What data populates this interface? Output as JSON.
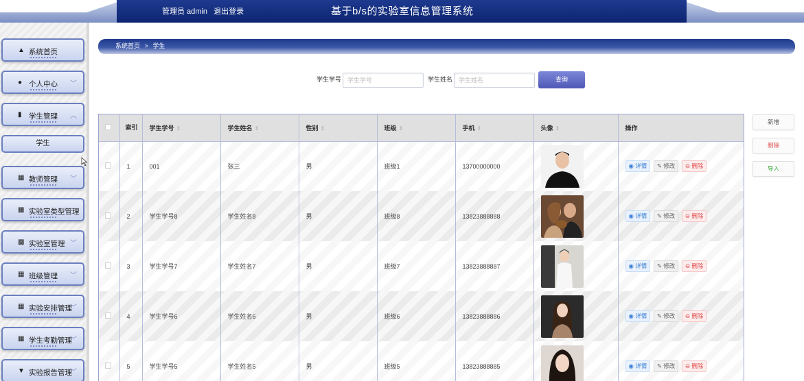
{
  "header": {
    "user_role": "管理员 admin",
    "logout": "退出登录",
    "title": "基于b/s的实验室信息管理系统"
  },
  "sidebar": {
    "items": [
      {
        "label": "系统首页",
        "icon": "home-icon",
        "arrow": ""
      },
      {
        "label": "个人中心",
        "icon": "user-icon",
        "arrow": "﹀"
      },
      {
        "label": "学生管理",
        "icon": "bar-chart-icon",
        "arrow": "︿"
      },
      {
        "label": "教师管理",
        "icon": "grid-icon",
        "arrow": "﹀"
      },
      {
        "label": "实验室类型管理",
        "icon": "grid-icon",
        "arrow": ""
      },
      {
        "label": "实验室管理",
        "icon": "card-icon",
        "arrow": "﹀"
      },
      {
        "label": "班级管理",
        "icon": "grid-icon",
        "arrow": "﹀"
      },
      {
        "label": "实验安排管理",
        "icon": "grid-icon",
        "arrow": "﹀"
      },
      {
        "label": "学生考勤管理",
        "icon": "grid-icon",
        "arrow": "﹀"
      },
      {
        "label": "实验报告管理",
        "icon": "report-icon",
        "arrow": "﹀"
      }
    ],
    "sub_item": "学生"
  },
  "breadcrumb": {
    "home": "系统首页",
    "sep": ">",
    "current": "学生"
  },
  "search": {
    "field1_label": "学生学号",
    "field1_placeholder": "学生学号",
    "field2_label": "学生姓名",
    "field2_placeholder": "学生姓名",
    "button": "查询"
  },
  "table": {
    "headers": [
      "索引",
      "学生学号",
      "学生姓名",
      "性别",
      "班级",
      "手机",
      "头像",
      "操作"
    ],
    "rows": [
      {
        "index": "1",
        "student_id": "001",
        "name": "张三",
        "gender": "男",
        "class": "班级1",
        "phone": "13700000000"
      },
      {
        "index": "2",
        "student_id": "学生学号8",
        "name": "学生姓名8",
        "gender": "男",
        "class": "班级8",
        "phone": "13823888888"
      },
      {
        "index": "3",
        "student_id": "学生学号7",
        "name": "学生姓名7",
        "gender": "男",
        "class": "班级7",
        "phone": "13823888887"
      },
      {
        "index": "4",
        "student_id": "学生学号6",
        "name": "学生姓名6",
        "gender": "男",
        "class": "班级6",
        "phone": "13823888886"
      },
      {
        "index": "5",
        "student_id": "学生学号5",
        "name": "学生姓名5",
        "gender": "男",
        "class": "班级5",
        "phone": "13823888885"
      }
    ],
    "ops": {
      "view": "详情",
      "edit": "修改",
      "delete": "删除"
    }
  },
  "side_buttons": {
    "add": "新增",
    "delete": "删除",
    "import": "导入"
  },
  "colors": {
    "header_blue": "#0d2470",
    "accent": "#4f58b5",
    "delete_red": "#e05050",
    "import_green": "#3aa53a"
  }
}
